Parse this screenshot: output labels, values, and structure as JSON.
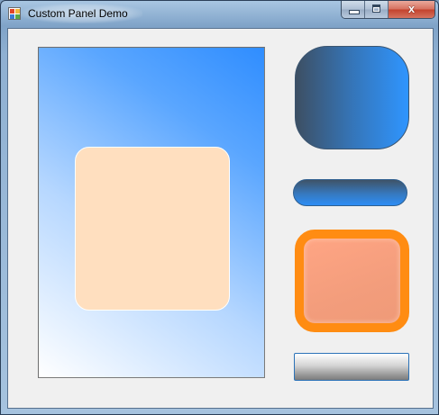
{
  "window": {
    "title": "Custom Panel Demo",
    "icon": "app-icon",
    "buttons": {
      "minimize_icon": "minimize-icon",
      "maximize_icon": "maximize-icon",
      "close_glyph": "x"
    }
  },
  "panels": [
    {
      "name": "gradient-panel",
      "colors": [
        "#ffffff",
        "#2f8dff"
      ]
    },
    {
      "name": "peach-rounded-panel",
      "color": "#ffdfbf"
    },
    {
      "name": "blue-rounded-panel",
      "colors": [
        "#3d4f63",
        "#2f95ff"
      ]
    },
    {
      "name": "blue-pill-panel",
      "colors": [
        "#3f5367",
        "#2d8df5"
      ]
    },
    {
      "name": "orange-bordered-panel",
      "border": "#ff8c12",
      "fill": "#f39d7c"
    },
    {
      "name": "gray-gradient-panel",
      "colors": [
        "#ffffff",
        "#7c7c7c"
      ],
      "border": "#2b72b8"
    }
  ]
}
